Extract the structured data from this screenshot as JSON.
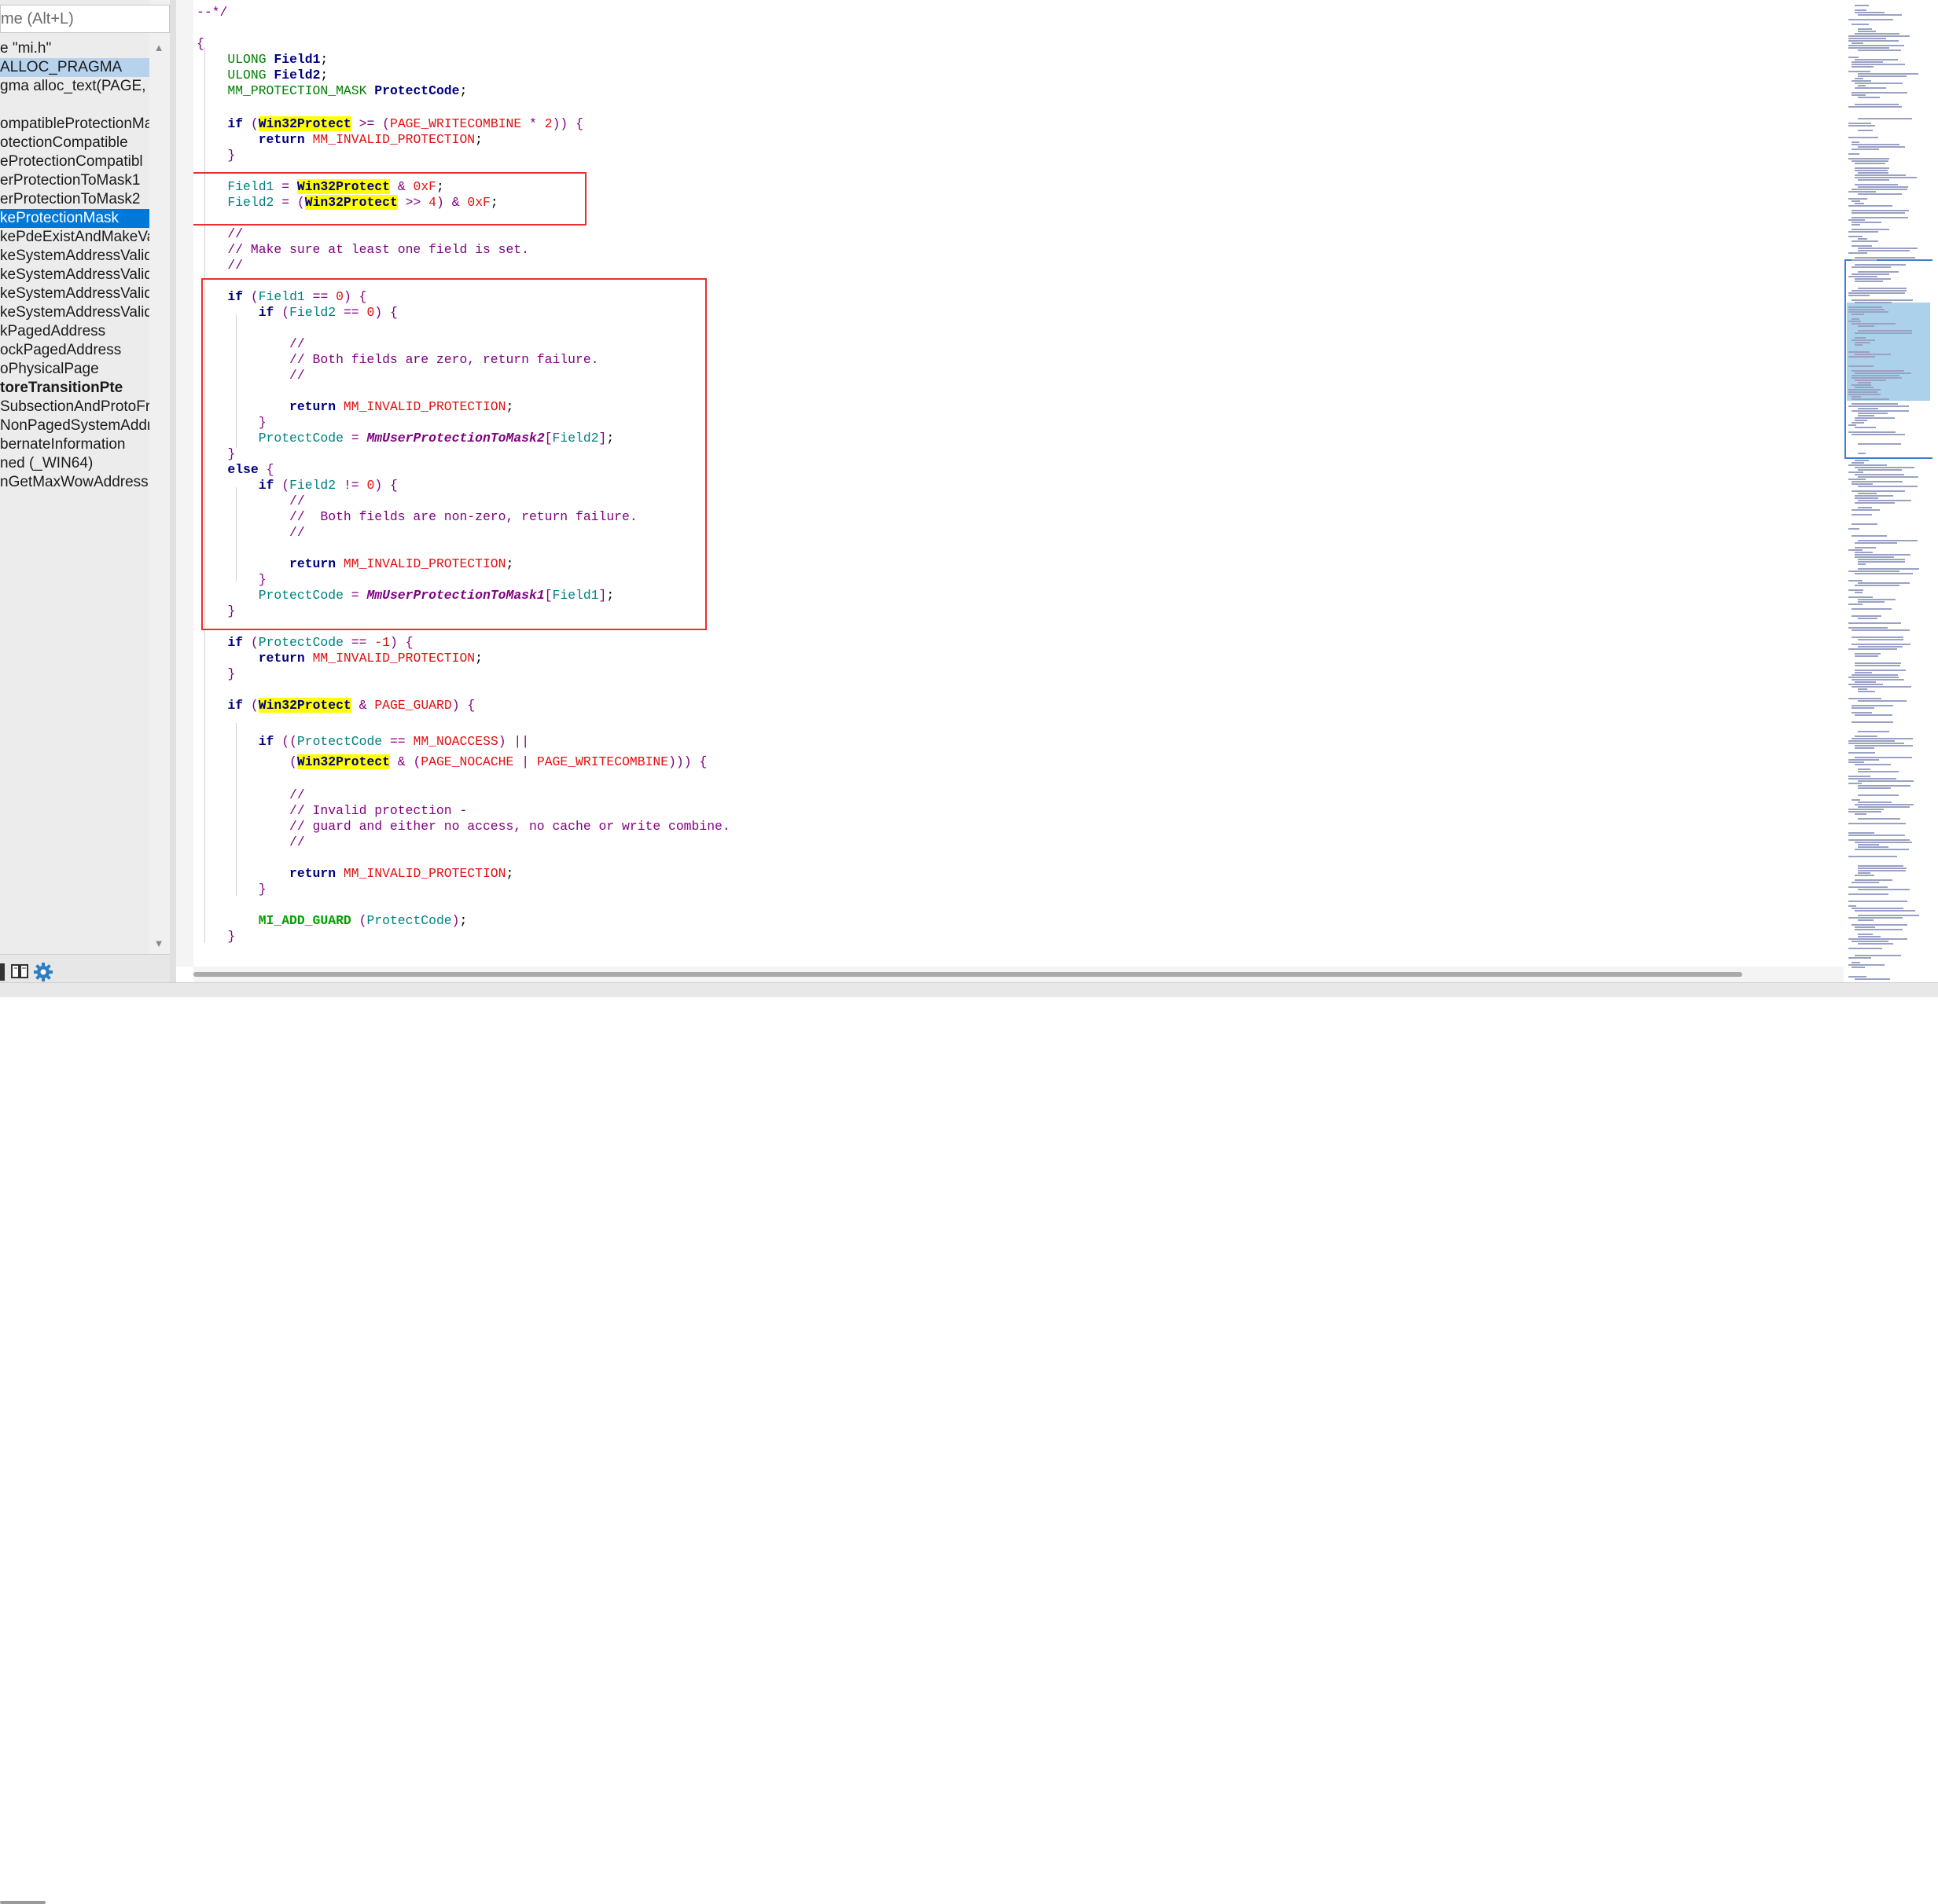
{
  "search": {
    "placeholder": "me (Alt+L)"
  },
  "symbols": [
    {
      "label": "e \"mi.h\"",
      "state": "normal"
    },
    {
      "label": "ALLOC_PRAGMA",
      "state": "soft"
    },
    {
      "label": "gma alloc_text(PAGE, N",
      "state": "normal"
    },
    {
      "label": "",
      "state": "normal"
    },
    {
      "label": "ompatibleProtectionMa",
      "state": "normal"
    },
    {
      "label": "otectionCompatible",
      "state": "normal"
    },
    {
      "label": "eProtectionCompatibl",
      "state": "normal"
    },
    {
      "label": "erProtectionToMask1",
      "state": "normal"
    },
    {
      "label": "erProtectionToMask2",
      "state": "normal"
    },
    {
      "label": "keProtectionMask",
      "state": "selected"
    },
    {
      "label": "kePdeExistAndMakeVa",
      "state": "normal"
    },
    {
      "label": "keSystemAddressValid",
      "state": "normal"
    },
    {
      "label": "keSystemAddressValid",
      "state": "normal"
    },
    {
      "label": "keSystemAddressValid",
      "state": "normal"
    },
    {
      "label": "keSystemAddressValid",
      "state": "normal"
    },
    {
      "label": "kPagedAddress",
      "state": "normal"
    },
    {
      "label": "ockPagedAddress",
      "state": "normal"
    },
    {
      "label": "oPhysicalPage",
      "state": "normal"
    },
    {
      "label": "toreTransitionPte",
      "state": "bold"
    },
    {
      "label": "SubsectionAndProtoFr",
      "state": "normal"
    },
    {
      "label": "NonPagedSystemAddr",
      "state": "normal"
    },
    {
      "label": "bernateInformation",
      "state": "normal"
    },
    {
      "label": "ned (_WIN64)",
      "state": "normal"
    },
    {
      "label": "nGetMaxWowAddress",
      "state": "normal"
    }
  ],
  "toolbar_icons": [
    "book-icon",
    "gear-icon"
  ],
  "code": {
    "l01": "--*/",
    "l02": "{",
    "field1_decl_type": "ULONG",
    "field1_decl_name": "Field1",
    "semi": ";",
    "field2_decl_type": "ULONG",
    "field2_decl_name": "Field2",
    "pc_decl_type": "MM_PROTECTION_MASK",
    "pc_decl_name": "ProtectCode",
    "kw_if": "if",
    "kw_else": "else",
    "kw_return": "return",
    "w32": "Win32Protect",
    "page_wc": "PAGE_WRITECOMBINE",
    "invalid": "MM_INVALID_PROTECTION",
    "field1": "Field1",
    "field2": "Field2",
    "protectcode": "ProtectCode",
    "hex_f": "0xF",
    "num4": "4",
    "num2": "2",
    "num0": "0",
    "num_m1": "-1",
    "c_empty": "//",
    "c_make_sure": "// Make sure at least one field is set.",
    "c_both_zero": "// Both fields are zero, return failure.",
    "c_both_nonzero": "//  Both fields are non-zero, return failure.",
    "mask2": "MmUserProtectionToMask2",
    "mask1": "MmUserProtectionToMask1",
    "page_guard": "PAGE_GUARD",
    "mm_noaccess": "MM_NOACCESS",
    "page_nocache": "PAGE_NOCACHE",
    "c_invalid": "// Invalid protection -",
    "c_guard": "// guard and either no access, no cache or write combine.",
    "mi_add_guard": "MI_ADD_GUARD"
  }
}
